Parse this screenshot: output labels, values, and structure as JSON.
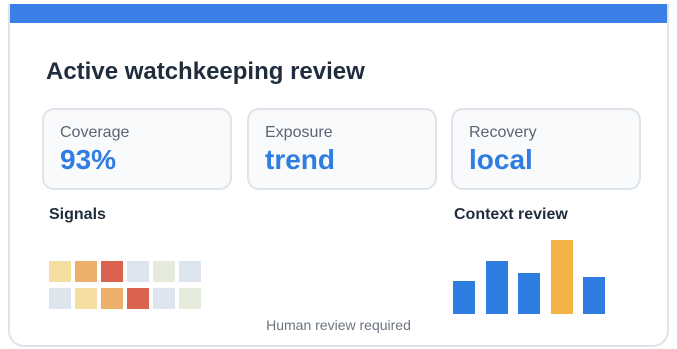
{
  "title": "Active watchkeeping review",
  "metrics": [
    {
      "label": "Coverage",
      "value": "93%"
    },
    {
      "label": "Exposure",
      "value": "trend"
    },
    {
      "label": "Recovery",
      "value": "local"
    }
  ],
  "signals": {
    "label": "Signals",
    "cells": [
      "#f5dfa0",
      "#ecb06b",
      "#d9634f",
      "#dde6ee",
      "#e6ecdc",
      "#dde6ee",
      "#dde6ee",
      "#f5dfa0",
      "#ecb06b",
      "#d9634f",
      "#dde6ee",
      "#e6ecdc"
    ]
  },
  "context_review": {
    "label": "Context review",
    "bars": [
      {
        "value": 0.45,
        "color": "#2f7de1"
      },
      {
        "value": 0.72,
        "color": "#2f7de1"
      },
      {
        "value": 0.55,
        "color": "#2f7de1"
      },
      {
        "value": 1.0,
        "color": "#f4b347"
      },
      {
        "value": 0.5,
        "color": "#2f7de1"
      }
    ]
  },
  "footer": "Human review required",
  "colors": {
    "accent": "#3a7fe6",
    "value_text": "#2f7de1",
    "highlight": "#f4b347"
  }
}
